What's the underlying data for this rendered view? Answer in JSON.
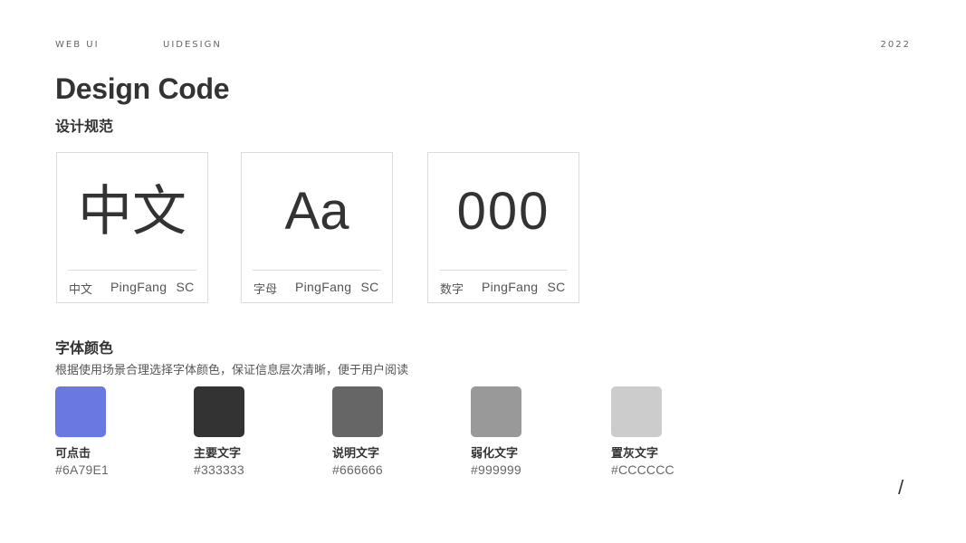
{
  "header": {
    "left_label": "WEB   UI",
    "center_label": "UIDESIGN",
    "year": "2022"
  },
  "title": "Design Code",
  "subtitle": "设计规范",
  "font_cards": [
    {
      "sample": "中文",
      "caption_left": "中文",
      "caption_right": "PingFang SC"
    },
    {
      "sample": "Aa",
      "caption_left": "字母",
      "caption_right": "PingFang SC"
    },
    {
      "sample": "000",
      "caption_left": "数字",
      "caption_right": "PingFang SC"
    }
  ],
  "colors_section": {
    "title": "字体颜色",
    "description": "根据使用场景合理选择字体颜色，保证信息层次清晰，便于用户阅读",
    "swatches": [
      {
        "name": "可点击",
        "hex": "#6A79E1"
      },
      {
        "name": "主要文字",
        "hex": "#333333"
      },
      {
        "name": "说明文字",
        "hex": "#666666"
      },
      {
        "name": "弱化文字",
        "hex": "#999999"
      },
      {
        "name": "置灰文字",
        "hex": "#CCCCCC"
      }
    ]
  },
  "footer_mark": "/"
}
